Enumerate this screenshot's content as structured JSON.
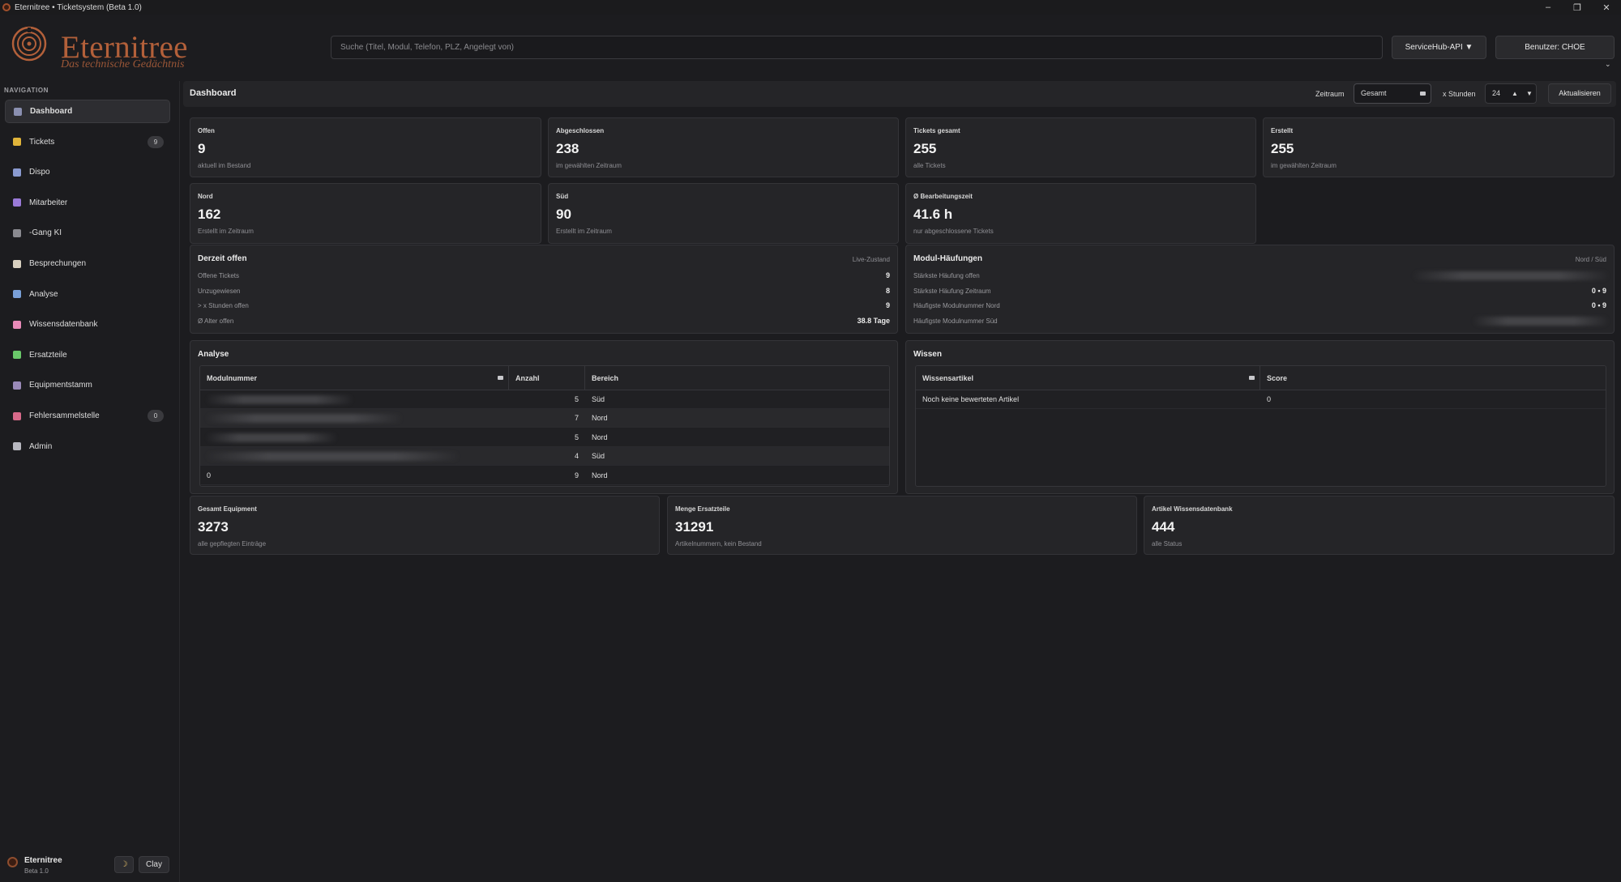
{
  "window": {
    "title": "Eternitree • Ticketsystem (Beta 1.0)",
    "controls": {
      "minimize": "–",
      "maximize": "❐",
      "close": "✕"
    }
  },
  "header": {
    "logo_text": "Eternitree",
    "logo_subtitle": "Das technische Gedächtnis",
    "search_placeholder": "Suche (Titel, Modul, Telefon, PLZ, Angelegt von)",
    "api_button": "ServiceHub-API ▼",
    "user_button": "Benutzer: CHOE",
    "user_chevron": "⌄"
  },
  "sidebar": {
    "title": "NAVIGATION",
    "items": [
      {
        "label": "Dashboard",
        "icon": "dashboard-icon",
        "color": "#8a8fb0",
        "active": true
      },
      {
        "label": "Tickets",
        "icon": "ticket-icon",
        "color": "#e0b43a",
        "badge": "9"
      },
      {
        "label": "Dispo",
        "icon": "calendar-icon",
        "color": "#8a9ad0"
      },
      {
        "label": "Mitarbeiter",
        "icon": "user-icon",
        "color": "#9a7ad8"
      },
      {
        "label": "-Gang KI",
        "icon": "robot-icon",
        "color": "#8a8a90"
      },
      {
        "label": "Besprechungen",
        "icon": "notes-icon",
        "color": "#d8d0c0"
      },
      {
        "label": "Analyse",
        "icon": "chart-icon",
        "color": "#7aa0d8"
      },
      {
        "label": "Wissensdatenbank",
        "icon": "brain-icon",
        "color": "#e88ab8"
      },
      {
        "label": "Ersatzteile",
        "icon": "puzzle-icon",
        "color": "#6ac86a"
      },
      {
        "label": "Equipmentstamm",
        "icon": "factory-icon",
        "color": "#9a8ab8"
      },
      {
        "label": "Fehlersammelstelle",
        "icon": "bug-icon",
        "color": "#d86a8a",
        "badge": "0"
      },
      {
        "label": "Admin",
        "icon": "gear-icon",
        "color": "#b8b8c0"
      }
    ],
    "footer": {
      "name": "Eternitree",
      "version": "Beta 1.0",
      "theme_icon": "☽",
      "theme_label": "Clay"
    }
  },
  "topbar": {
    "title": "Dashboard",
    "zeitraum_label": "Zeitraum",
    "zeitraum_value": "Gesamt",
    "xstunden_label": "x Stunden",
    "xstunden_value": "24",
    "up_arrow": "▲",
    "down_arrow": "▼",
    "refresh": "Aktualisieren"
  },
  "kpis": [
    {
      "label": "Offen",
      "value": "9",
      "sub": "aktuell im Bestand"
    },
    {
      "label": "Abgeschlossen",
      "value": "238",
      "sub": "im gewählten Zeitraum"
    },
    {
      "label": "Tickets gesamt",
      "value": "255",
      "sub": "alle Tickets"
    },
    {
      "label": "Erstellt",
      "value": "255",
      "sub": "im gewählten Zeitraum"
    },
    {
      "label": "Nord",
      "value": "162",
      "sub": "Erstellt im Zeitraum"
    },
    {
      "label": "Süd",
      "value": "90",
      "sub": "Erstellt im Zeitraum"
    },
    {
      "label": "Ø Bearbeitungszeit",
      "value": "41.6 h",
      "sub": "nur abgeschlossene Tickets"
    }
  ],
  "derzeit": {
    "title": "Derzeit offen",
    "tag": "Live-Zustand",
    "rows": [
      {
        "label": "Offene Tickets",
        "value": "9"
      },
      {
        "label": "Unzugewiesen",
        "value": "8"
      },
      {
        "label": "> x Stunden offen",
        "value": "9"
      },
      {
        "label": "Ø Alter offen",
        "value": "38.8 Tage"
      }
    ]
  },
  "modul": {
    "title": "Modul-Häufungen",
    "tag": "Nord / Süd",
    "rows": [
      {
        "label": "Stärkste Häufung offen",
        "value": ""
      },
      {
        "label": "Stärkste Häufung Zeitraum",
        "value": "0 • 9"
      },
      {
        "label": "Häufigste Modulnummer Nord",
        "value": "0 • 9"
      },
      {
        "label": "Häufigste Modulnummer Süd",
        "value": ""
      }
    ]
  },
  "analyse": {
    "title": "Analyse",
    "columns": [
      "Modulnummer",
      "Anzahl",
      "Bereich"
    ],
    "rows": [
      {
        "modul": "",
        "anzahl": "5",
        "bereich": "Süd"
      },
      {
        "modul": "",
        "anzahl": "7",
        "bereich": "Nord"
      },
      {
        "modul": "",
        "anzahl": "5",
        "bereich": "Nord"
      },
      {
        "modul": "",
        "anzahl": "4",
        "bereich": "Süd"
      },
      {
        "modul": "0",
        "anzahl": "9",
        "bereich": "Nord"
      }
    ]
  },
  "wissen": {
    "title": "Wissen",
    "columns": [
      "Wissensartikel",
      "Score"
    ],
    "rows": [
      {
        "artikel": "Noch keine bewerteten Artikel",
        "score": "0"
      }
    ]
  },
  "bottom_kpis": [
    {
      "label": "Gesamt Equipment",
      "value": "3273",
      "sub": "alle gepflegten Einträge"
    },
    {
      "label": "Menge Ersatzteile",
      "value": "31291",
      "sub": "Artikelnummern, kein Bestand"
    },
    {
      "label": "Artikel Wissensdatenbank",
      "value": "444",
      "sub": "alle Status"
    }
  ]
}
